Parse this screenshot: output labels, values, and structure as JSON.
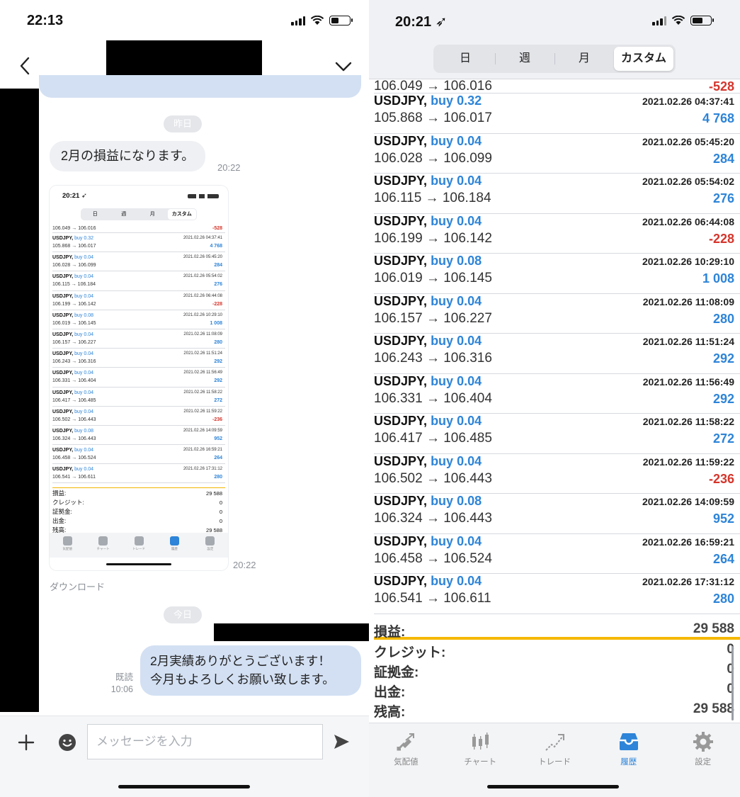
{
  "chat": {
    "status_time": "22:13",
    "date_yesterday": "昨日",
    "date_today": "今日",
    "incoming_text": "2月の損益になります。",
    "incoming_time": "20:22",
    "image_time": "20:22",
    "download_label": "ダウンロード",
    "outgoing_line1": "2月実績ありがとうございます！",
    "outgoing_line2": "今月もよろしくお願い致します。",
    "read_label": "既読",
    "outgoing_time": "10:06",
    "input_placeholder": "メッセージを入力"
  },
  "thumb": {
    "status_time": "20:21 ➶",
    "tabs": [
      "日",
      "週",
      "月",
      "カスタム"
    ],
    "first_row": {
      "price": "106.049 → 106.016",
      "profit": "-528"
    },
    "rows": [
      {
        "symbol": "USDJPY,",
        "side": "buy 0.32",
        "date": "2021.02.26 04:37:41",
        "price": "105.868 → 106.017",
        "profit": "4 768"
      },
      {
        "symbol": "USDJPY,",
        "side": "buy 0.04",
        "date": "2021.02.26 05:45:20",
        "price": "106.028 → 106.099",
        "profit": "284"
      },
      {
        "symbol": "USDJPY,",
        "side": "buy 0.04",
        "date": "2021.02.26 05:54:02",
        "price": "106.115 → 106.184",
        "profit": "276"
      },
      {
        "symbol": "USDJPY,",
        "side": "buy 0.04",
        "date": "2021.02.26 06:44:08",
        "price": "106.199 → 106.142",
        "profit": "-228"
      },
      {
        "symbol": "USDJPY,",
        "side": "buy 0.08",
        "date": "2021.02.26 10:29:10",
        "price": "106.019 → 106.145",
        "profit": "1 008"
      },
      {
        "symbol": "USDJPY,",
        "side": "buy 0.04",
        "date": "2021.02.26 11:08:09",
        "price": "106.157 → 106.227",
        "profit": "280"
      },
      {
        "symbol": "USDJPY,",
        "side": "buy 0.04",
        "date": "2021.02.26 11:51:24",
        "price": "106.243 → 106.316",
        "profit": "292"
      },
      {
        "symbol": "USDJPY,",
        "side": "buy 0.04",
        "date": "2021.02.26 11:56:49",
        "price": "106.331 → 106.404",
        "profit": "292"
      },
      {
        "symbol": "USDJPY,",
        "side": "buy 0.04",
        "date": "2021.02.26 11:58:22",
        "price": "106.417 → 106.485",
        "profit": "272"
      },
      {
        "symbol": "USDJPY,",
        "side": "buy 0.04",
        "date": "2021.02.26 11:59:22",
        "price": "106.502 → 106.443",
        "profit": "-236"
      },
      {
        "symbol": "USDJPY,",
        "side": "buy 0.08",
        "date": "2021.02.26 14:09:59",
        "price": "106.324 → 106.443",
        "profit": "952"
      },
      {
        "symbol": "USDJPY,",
        "side": "buy 0.04",
        "date": "2021.02.26 16:59:21",
        "price": "106.458 → 106.524",
        "profit": "264"
      },
      {
        "symbol": "USDJPY,",
        "side": "buy 0.04",
        "date": "2021.02.26 17:31:12",
        "price": "106.541 → 106.611",
        "profit": "280"
      }
    ],
    "summary": [
      {
        "label": "損益:",
        "value": "29 588"
      },
      {
        "label": "クレジット:",
        "value": "0"
      },
      {
        "label": "証拠金:",
        "value": "0"
      },
      {
        "label": "出金:",
        "value": "0"
      },
      {
        "label": "残高:",
        "value": "29 588"
      }
    ],
    "tabbar": [
      "気配値",
      "チャート",
      "トレード",
      "履歴",
      "設定"
    ]
  },
  "history": {
    "status_time": "20:21 ➶",
    "tabs": [
      "日",
      "週",
      "月",
      "カスタム"
    ],
    "first_row": {
      "price": "106.049 → 106.016",
      "profit": "-528"
    },
    "rows": [
      {
        "symbol": "USDJPY,",
        "side": "buy 0.32",
        "date": "2021.02.26 04:37:41",
        "price": "105.868 → 106.017",
        "profit": "4 768"
      },
      {
        "symbol": "USDJPY,",
        "side": "buy 0.04",
        "date": "2021.02.26 05:45:20",
        "price": "106.028 → 106.099",
        "profit": "284"
      },
      {
        "symbol": "USDJPY,",
        "side": "buy 0.04",
        "date": "2021.02.26 05:54:02",
        "price": "106.115 → 106.184",
        "profit": "276"
      },
      {
        "symbol": "USDJPY,",
        "side": "buy 0.04",
        "date": "2021.02.26 06:44:08",
        "price": "106.199 → 106.142",
        "profit": "-228"
      },
      {
        "symbol": "USDJPY,",
        "side": "buy 0.08",
        "date": "2021.02.26 10:29:10",
        "price": "106.019 → 106.145",
        "profit": "1 008"
      },
      {
        "symbol": "USDJPY,",
        "side": "buy 0.04",
        "date": "2021.02.26 11:08:09",
        "price": "106.157 → 106.227",
        "profit": "280"
      },
      {
        "symbol": "USDJPY,",
        "side": "buy 0.04",
        "date": "2021.02.26 11:51:24",
        "price": "106.243 → 106.316",
        "profit": "292"
      },
      {
        "symbol": "USDJPY,",
        "side": "buy 0.04",
        "date": "2021.02.26 11:56:49",
        "price": "106.331 → 106.404",
        "profit": "292"
      },
      {
        "symbol": "USDJPY,",
        "side": "buy 0.04",
        "date": "2021.02.26 11:58:22",
        "price": "106.417 → 106.485",
        "profit": "272"
      },
      {
        "symbol": "USDJPY,",
        "side": "buy 0.04",
        "date": "2021.02.26 11:59:22",
        "price": "106.502 → 106.443",
        "profit": "-236"
      },
      {
        "symbol": "USDJPY,",
        "side": "buy 0.08",
        "date": "2021.02.26 14:09:59",
        "price": "106.324 → 106.443",
        "profit": "952"
      },
      {
        "symbol": "USDJPY,",
        "side": "buy 0.04",
        "date": "2021.02.26 16:59:21",
        "price": "106.458 → 106.524",
        "profit": "264"
      },
      {
        "symbol": "USDJPY,",
        "side": "buy 0.04",
        "date": "2021.02.26 17:31:12",
        "price": "106.541 → 106.611",
        "profit": "280"
      }
    ],
    "summary": [
      {
        "label": "損益:",
        "value": "29 588"
      },
      {
        "label": "クレジット:",
        "value": "0"
      },
      {
        "label": "証拠金:",
        "value": "0"
      },
      {
        "label": "出金:",
        "value": "0"
      },
      {
        "label": "残高:",
        "value": "29 588"
      }
    ],
    "tabbar": [
      {
        "label": "気配値",
        "icon": "quotes-icon"
      },
      {
        "label": "チャート",
        "icon": "chart-icon"
      },
      {
        "label": "トレード",
        "icon": "trade-icon"
      },
      {
        "label": "履歴",
        "icon": "history-icon",
        "active": true
      },
      {
        "label": "設定",
        "icon": "settings-icon"
      }
    ]
  },
  "colors": {
    "accent": "#2d84d8",
    "negative": "#d5352c",
    "summary_line": "#f5b800",
    "chat_outgoing": "#d3e0f3"
  }
}
